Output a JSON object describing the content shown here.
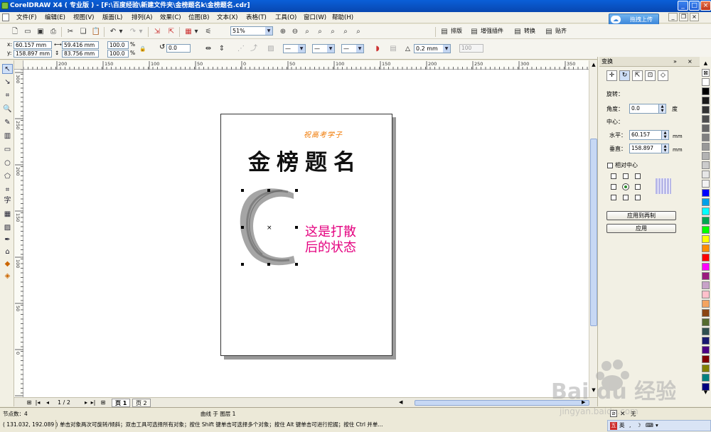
{
  "title_bar": {
    "text": "CorelDRAW X4 ( 专业版 ) - [F:\\百度经验\\新建文件夹\\金榜题名k\\金榜题名.cdr]"
  },
  "menu": [
    "文件(F)",
    "编辑(E)",
    "视图(V)",
    "版面(L)",
    "排列(A)",
    "效果(C)",
    "位图(B)",
    "文本(X)",
    "表格(T)",
    "工具(O)",
    "窗口(W)",
    "帮助(H)"
  ],
  "upload_button": "拖拽上传",
  "toolbar1": {
    "zoom": "51%",
    "right_tools": [
      "排版",
      "增强插件",
      "转换",
      "贴齐"
    ]
  },
  "property_bar": {
    "x": "60.157 mm",
    "y": "158.897 mm",
    "width": "59.416 mm",
    "height": "83.756 mm",
    "scale_x": "100.0",
    "scale_y": "100.0",
    "pct": "%",
    "rotation": "0.0",
    "outline_width": "0.2 mm",
    "extra": "100"
  },
  "ruler": {
    "top_ticks": [
      "200",
      "150",
      "100",
      "50",
      "0",
      "50",
      "100",
      "150",
      "200",
      "250",
      "300",
      "350",
      "400"
    ],
    "left_ticks": [
      "300",
      "250",
      "200",
      "150",
      "100",
      "50",
      "0",
      "-50"
    ]
  },
  "page_content": {
    "subtitle": "祝高考学子",
    "title": "金榜题名",
    "note_line1": "这是打散",
    "note_line2": "后的状态"
  },
  "page_nav": {
    "counter": "1 / 2",
    "tabs": [
      "页 1",
      "页 2"
    ]
  },
  "docker": {
    "title": "变换",
    "section": "旋转：",
    "angle_label": "角度：",
    "angle_value": "0.0",
    "angle_unit": "度",
    "center_label": "中心：",
    "h_label": "水平：",
    "h_value": "60.157",
    "v_label": "垂直：",
    "v_value": "158.897",
    "unit": "mm",
    "relative_center": "相对中心",
    "apply_dup": "应用到再制",
    "apply": "应用"
  },
  "palette_colors": [
    "#ffffff",
    "#000000",
    "#1a1a1a",
    "#333333",
    "#4d4d4d",
    "#666666",
    "#808080",
    "#999999",
    "#b3b3b3",
    "#cccccc",
    "#e6e6e6",
    "#f2f2f2",
    "#0000ff",
    "#00a0e9",
    "#00ffff",
    "#00a651",
    "#00ff00",
    "#ffff00",
    "#ff8c00",
    "#ff0000",
    "#ff00ff",
    "#9b1b7f",
    "#c8a2c8",
    "#ffc0cb",
    "#f4a460",
    "#8b4513",
    "#556b2f",
    "#2f4f4f",
    "#191970",
    "#4b0082",
    "#800000",
    "#808000",
    "#008080",
    "#000080"
  ],
  "status": {
    "nodes": "节点数：4",
    "layer": "曲线 于 图层 1",
    "coords": "( 131.032, 192.089 )",
    "hint": "单击对象两次可旋转/倾斜；双击工具可选择所有对象；按住 Shift 键单击可选择多个对象；按住 Alt 键单击可进行挖掘；按住 Ctrl 并单...",
    "fill_none": "无",
    "ime": "英"
  },
  "watermark": {
    "brand": "Bai du 经验",
    "url": "jingyan.baidu.com"
  }
}
